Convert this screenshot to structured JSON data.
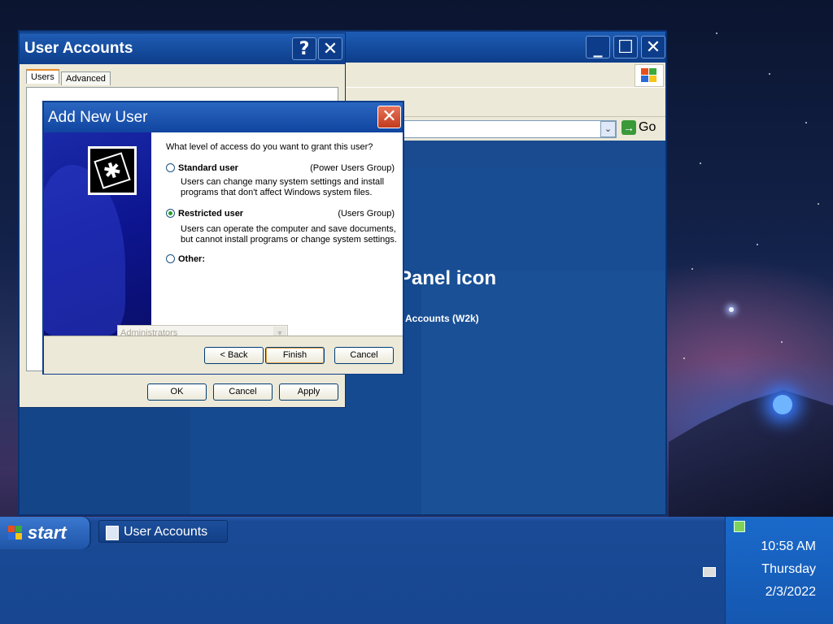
{
  "taskbar": {
    "start_label": "start",
    "task_item_label": "User Accounts",
    "clock_time": "10:58 AM",
    "clock_day": "Thursday",
    "clock_date": "2/3/2022"
  },
  "main_window": {
    "go_label": "Go",
    "heading": "Panel icon",
    "subheading": "Accounts (W2k)"
  },
  "user_accounts_dialog": {
    "title": "User Accounts",
    "help_label": "?",
    "close_label": "✕",
    "tabs": [
      {
        "label": "Users",
        "active": true
      },
      {
        "label": "Advanced",
        "active": false
      }
    ],
    "buttons": {
      "ok": "OK",
      "cancel": "Cancel",
      "apply": "Apply"
    }
  },
  "add_user_wizard": {
    "title": "Add New User",
    "question": "What level of access do you want to grant this user?",
    "options": [
      {
        "label": "Standard user",
        "group": "(Power Users Group)",
        "description": "Users can change many system settings and install programs that don't affect Windows system files.",
        "selected": false
      },
      {
        "label": "Restricted user",
        "group": "(Users Group)",
        "description": "Users can operate the computer and save documents, but cannot install programs or change system settings.",
        "selected": true
      },
      {
        "label": "Other:",
        "selected": false,
        "combo_value": "Administrators",
        "combo_disabled": true
      }
    ],
    "buttons": {
      "back": "< Back",
      "finish": "Finish",
      "cancel": "Cancel"
    }
  },
  "colors": {
    "xp_blue": "#0d3d8a",
    "dialog_face": "#ece9d8",
    "close_red": "#c23b1e",
    "radio_green": "#21a121"
  }
}
